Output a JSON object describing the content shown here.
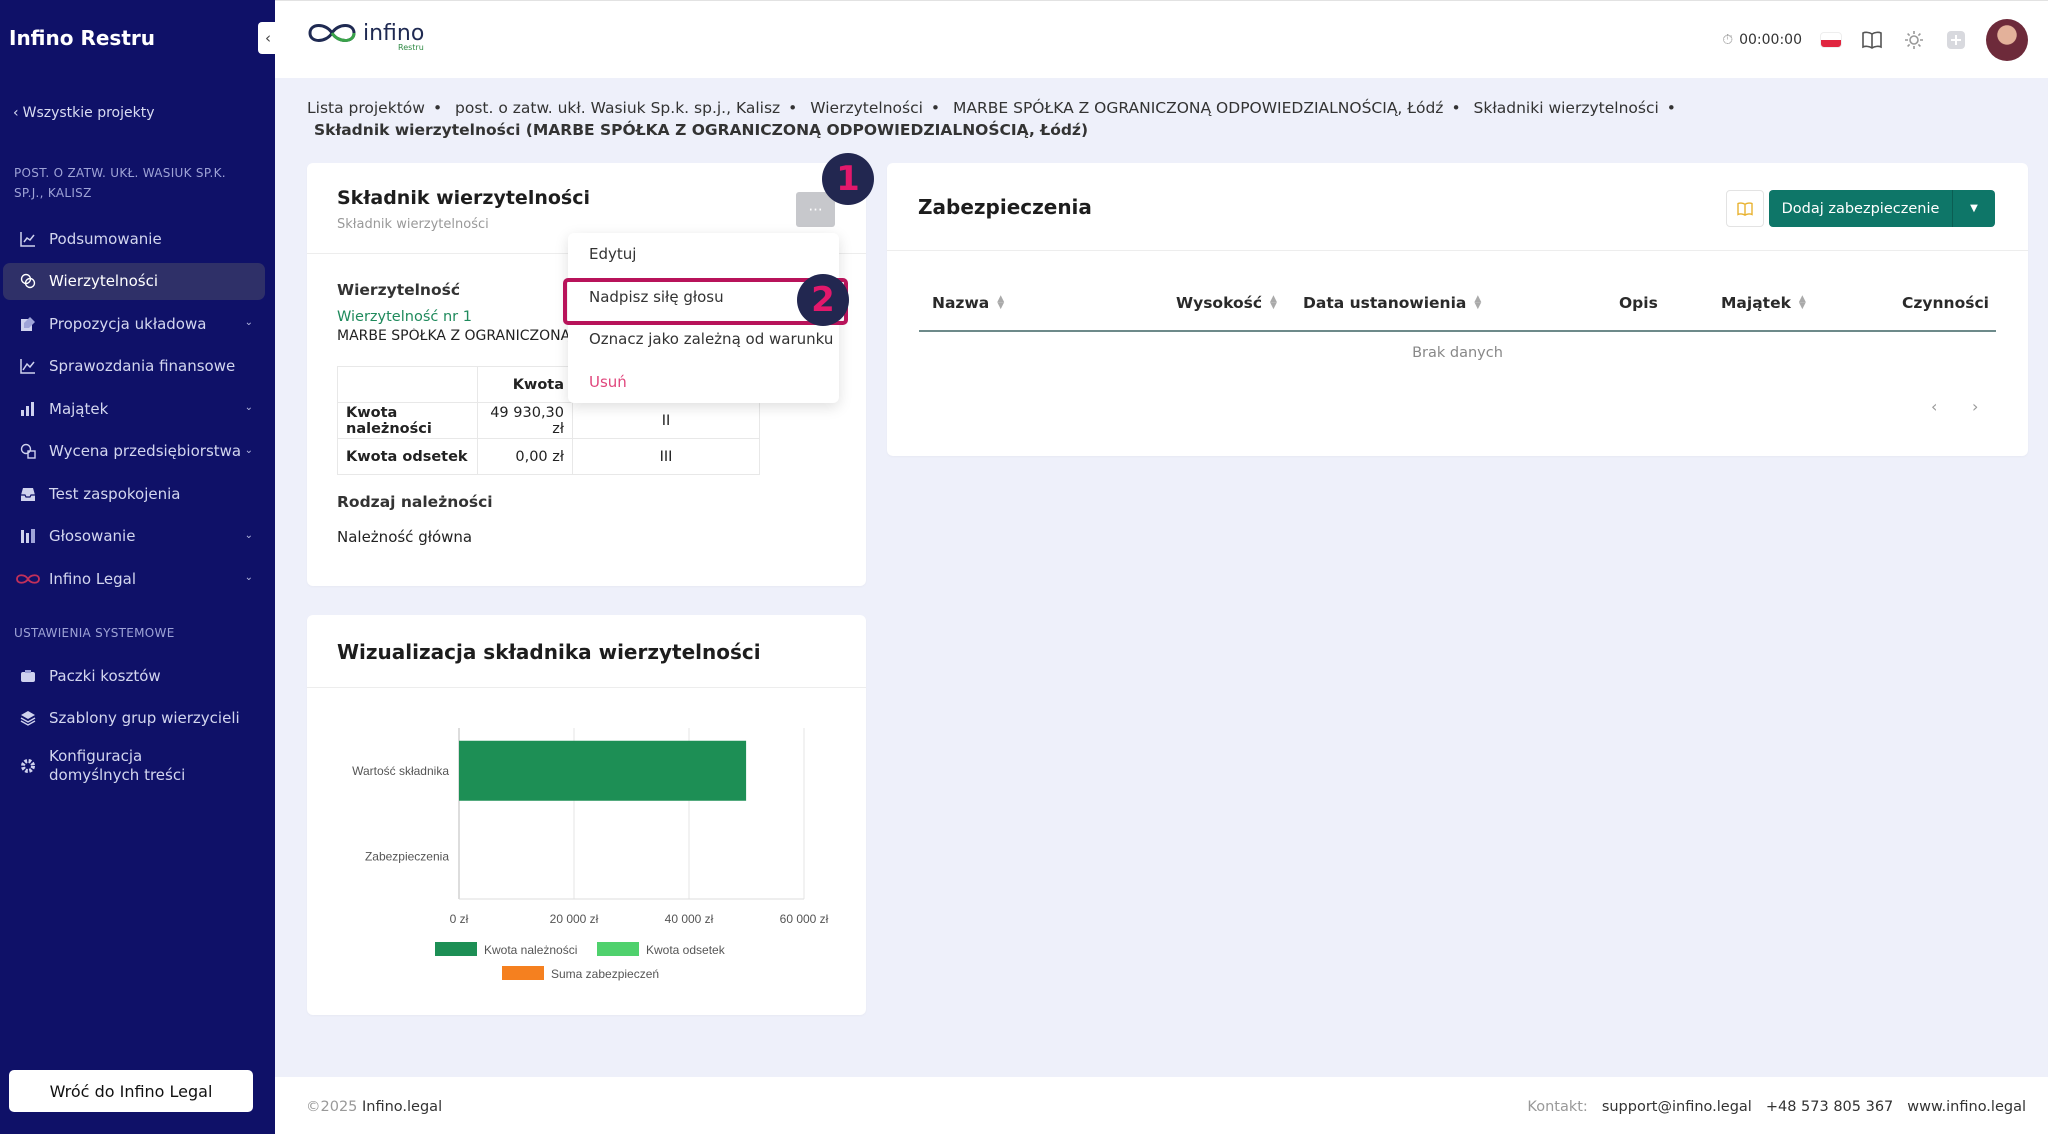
{
  "sidebar": {
    "title": "Infino Restru",
    "collapse_icon": "‹",
    "back_link": "Wszystkie projekty",
    "project_name": "POST. O ZATW. UKŁ. WASIUK SP.K. SP.J., KALISZ",
    "items": [
      {
        "label": "Podsumowanie",
        "icon": "chart-line-icon"
      },
      {
        "label": "Wierzytelności",
        "icon": "coins-icon",
        "active": true
      },
      {
        "label": "Propozycja układowa",
        "icon": "edit-icon",
        "chevron": true
      },
      {
        "label": "Sprawozdania finansowe",
        "icon": "chart-area-icon"
      },
      {
        "label": "Majątek",
        "icon": "chart-bar-icon",
        "chevron": true
      },
      {
        "label": "Wycena przedsiębiorstwa",
        "icon": "valuation-icon",
        "chevron": true
      },
      {
        "label": "Test zaspokojenia",
        "icon": "inbox-icon"
      },
      {
        "label": "Głosowanie",
        "icon": "voting-icon",
        "chevron": true
      },
      {
        "label": "Infino Legal",
        "icon": "infinity-icon",
        "chevron": true
      }
    ],
    "system_section": "USTAWIENIA SYSTEMOWE",
    "system_items": [
      {
        "label": "Paczki kosztów",
        "icon": "package-icon"
      },
      {
        "label": "Szablony grup wierzycieli",
        "icon": "layers-icon"
      },
      {
        "label": "Konfiguracja domyślnych treści",
        "icon": "gear-icon"
      }
    ],
    "back_button": "Wróć do Infino Legal"
  },
  "topbar": {
    "logo_text": "infino",
    "logo_sub": "Restru",
    "timer": "00:00:00"
  },
  "breadcrumb": {
    "items": [
      "Lista projektów",
      "post. o zatw. ukł. Wasiuk Sp.k. sp.j., Kalisz",
      "Wierzytelności",
      "MARBE SPÓŁKA Z OGRANICZONĄ ODPOWIEDZIALNOŚCIĄ, Łódź",
      "Składniki wierzytelności"
    ],
    "separator": "•",
    "current": "Składnik wierzytelności (MARBE SPÓŁKA Z OGRANICZONĄ ODPOWIEDZIALNOŚCIĄ, Łódź)"
  },
  "component_card": {
    "title": "Składnik wierzytelności",
    "subtitle": "Składnik wierzytelności",
    "more_label": "···",
    "claim_label": "Wierzytelność",
    "claim_link": "Wierzytelność nr 1",
    "creditor": "MARBE SPÓŁKA Z OGRANICZONĄ ODPOWIEDZIALNOŚCIĄ, Łódź",
    "table": {
      "header_col": "Kwota",
      "rows": [
        {
          "label": "Kwota należności",
          "amount": "49 930,30 zł",
          "category": "II"
        },
        {
          "label": "Kwota odsetek",
          "amount": "0,00 zł",
          "category": "III"
        }
      ]
    },
    "type_label": "Rodzaj należności",
    "type_value": "Należność główna"
  },
  "dropdown_menu": {
    "items": [
      "Edytuj",
      "Nadpisz siłę głosu",
      "Oznacz jako zależną od warunku",
      "Usuń"
    ]
  },
  "badges": [
    "1",
    "2"
  ],
  "security_card": {
    "title": "Zabezpieczenia",
    "add_button": "Dodaj zabezpieczenie",
    "columns": [
      "Nazwa",
      "Wysokość",
      "Data ustanowienia",
      "Opis",
      "Majątek",
      "Czynności"
    ],
    "empty_text": "Brak danych",
    "prev": "‹",
    "next": "›"
  },
  "chart_card": {
    "title": "Wizualizacja składnika wierzytelności"
  },
  "chart_data": {
    "type": "bar",
    "orientation": "horizontal",
    "stacked": true,
    "categories": [
      "Wartość składnika",
      "Zabezpieczenia"
    ],
    "series": [
      {
        "name": "Kwota należności",
        "values": [
          49930.3,
          0
        ],
        "color": "#1d8f55"
      },
      {
        "name": "Kwota odsetek",
        "values": [
          0,
          0
        ],
        "color": "#4fd16d"
      },
      {
        "name": "Suma zabezpieczeń",
        "values": [
          0,
          0
        ],
        "color": "#f5801f"
      }
    ],
    "xlim": [
      0,
      60000
    ],
    "ticks": [
      "0 zł",
      "20 000 zł",
      "40 000 zł",
      "60 000 zł"
    ],
    "tick_values": [
      0,
      20000,
      40000,
      60000
    ],
    "grid": true,
    "legend": "bottom"
  },
  "footer": {
    "copyright": "©2025",
    "brand": "Infino.legal",
    "contact_label": "Kontakt:",
    "email": "support@infino.legal",
    "phone": "+48 573 805 367",
    "website": "www.infino.legal"
  },
  "colors": {
    "sidebar_bg": "#0f1168",
    "accent": "#0e7668",
    "danger": "#e0467c",
    "highlight": "#b8135a"
  }
}
